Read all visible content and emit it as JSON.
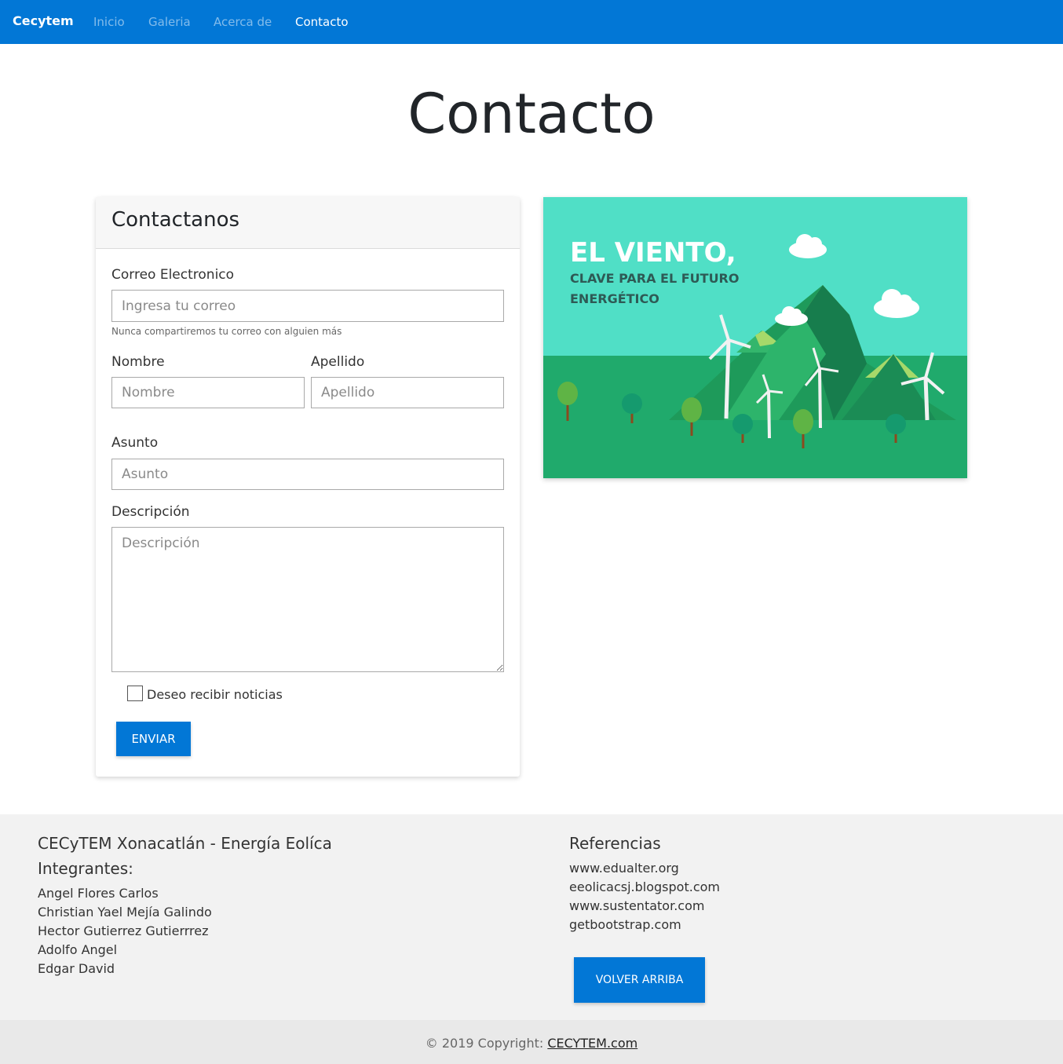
{
  "nav": {
    "brand": "Cecytem",
    "links": [
      "Inicio",
      "Galeria",
      "Acerca de",
      "Contacto"
    ],
    "active": "Contacto"
  },
  "page": {
    "title": "Contacto"
  },
  "form": {
    "header": "Contactanos",
    "email_label": "Correo Electronico",
    "email_placeholder": "Ingresa tu correo",
    "email_help": "Nunca compartiremos tu correo con alguien más",
    "nombre_label": "Nombre",
    "nombre_placeholder": "Nombre",
    "apellido_label": "Apellido",
    "apellido_placeholder": "Apellido",
    "asunto_label": "Asunto",
    "asunto_placeholder": "Asunto",
    "descripcion_label": "Descripción",
    "descripcion_placeholder": "Descripción",
    "newsletter_label": "Deseo recibir noticias",
    "submit_label": "ENVIAR"
  },
  "illustration": {
    "headline": "EL VIENTO,",
    "subline1": "CLAVE PARA EL FUTURO",
    "subline2": "ENERGÉTICO",
    "colors": {
      "sky": "#50dfc6",
      "ground": "#20aa6c",
      "mountain": "#22a05f",
      "accent": "#a6d96a"
    }
  },
  "footer": {
    "school": "CECyTEM Xonacatlán - Energía Eolíca",
    "members_title": "Integrantes:",
    "members": [
      "Angel Flores Carlos",
      "Christian Yael Mejía Galindo",
      "Hector Gutierrez Gutierrrez",
      "Adolfo Angel",
      "Edgar David"
    ],
    "refs_title": "Referencias",
    "refs": [
      "www.edualter.org",
      "eeolicacsj.blogspot.com",
      "www.sustentator.com",
      "getbootstrap.com"
    ],
    "back_top_label": "VOLVER ARRIBA",
    "copyright_prefix": "© 2019 Copyright: ",
    "copyright_link": "CECYTEM.com"
  },
  "theme": {
    "primary": "#0277d6"
  }
}
